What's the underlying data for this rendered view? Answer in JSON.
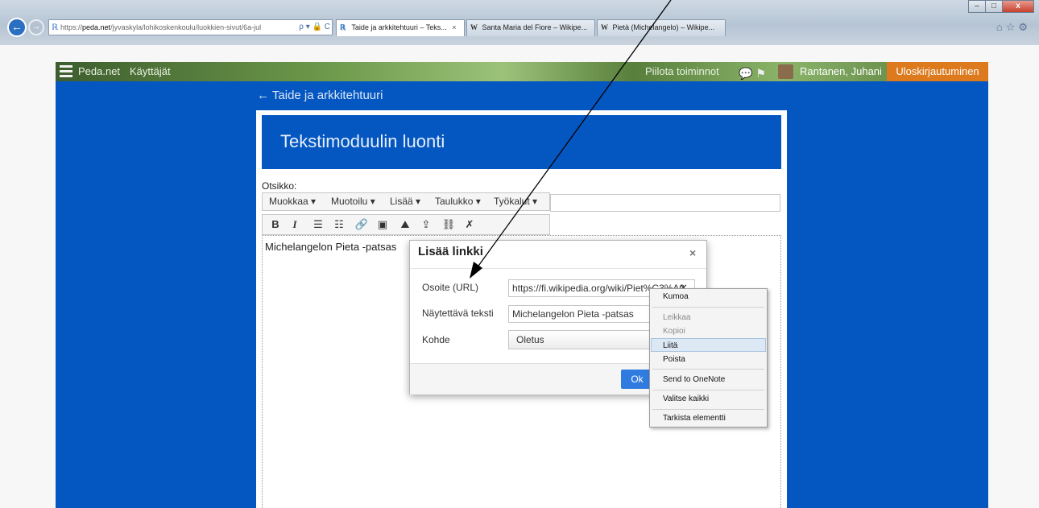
{
  "browser": {
    "address": {
      "prefix": "https://",
      "host": "peda.net",
      "path": "/jyvaskyla/lohikoskenkoulu/luokkien-sivut/6a-jul",
      "tools": "ρ ▾ 🔒 C"
    },
    "tabs": [
      {
        "icon": "ℝ",
        "label": "Taide ja arkkitehtuuri – Teks...",
        "close": "×"
      },
      {
        "icon": "W",
        "label": "Santa Maria del Fiore – Wikipe..."
      },
      {
        "icon": "W",
        "label": "Pietà (Michelangelo) – Wikipe..."
      }
    ],
    "window_buttons": {
      "minimize": "–",
      "maximize": "□",
      "close": "x"
    },
    "icons": [
      "home-icon",
      "star-icon",
      "gear-icon"
    ]
  },
  "site_header": {
    "brand": "Peda.net",
    "users": "Käyttäjät",
    "hide_actions": "Piilota toiminnot",
    "user_name": "Rantanen, Juhani",
    "logout": "Uloskirjautuminen"
  },
  "breadcrumb": "← Taide ja arkkitehtuuri",
  "module": {
    "title": "Tekstimoduulin luonti",
    "field_label": "Otsikko:"
  },
  "editor": {
    "menu": [
      "Muokkaa ▾",
      "Muotoilu ▾",
      "Lisää ▾",
      "Taulukko ▾",
      "Työkalut ▾"
    ],
    "toolbar": {
      "bold": "B",
      "italic": "I",
      "bullet_list": "☰",
      "numbered_list": "☷",
      "link": "🔗",
      "image": "▣",
      "media": "⛰",
      "upload": "⇪",
      "unlink": "⛓",
      "clear_format": "✗"
    },
    "content": "Michelangelon Pieta -patsas"
  },
  "dialog": {
    "title": "Lisää linkki",
    "close": "×",
    "url_label": "Osoite (URL)",
    "url_value": "https://fi.wikipedia.org/wiki/Piet%C3%A0",
    "url_clear": "✕",
    "text_label": "Näytettävä teksti",
    "text_value": "Michelangelon Pieta -patsas",
    "target_label": "Kohde",
    "target_value": "Oletus",
    "ok": "Ok"
  },
  "context_menu": {
    "items": [
      "Kumoa",
      "Leikkaa",
      "Kopioi",
      "Liitä",
      "Poista",
      "Send to OneNote",
      "Valitse kaikki",
      "Tarkista elementti"
    ]
  },
  "colors": {
    "site_blue": "#0457c1",
    "logout_orange": "#dd7a1d",
    "ok_blue": "#2f7be0"
  }
}
